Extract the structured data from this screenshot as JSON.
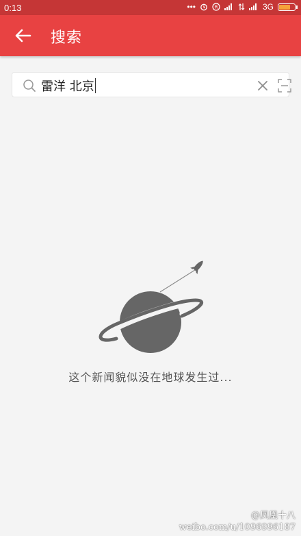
{
  "status_bar": {
    "time": "0:13",
    "network_label": "3G",
    "battery_level": 0.75,
    "icons": [
      "more-dots-icon",
      "alarm-icon",
      "r-circle-icon",
      "signal-icon",
      "data-arrows-icon",
      "signal-icon",
      "battery-icon"
    ]
  },
  "app_bar": {
    "title": "搜索",
    "back_icon": "arrow-left-icon",
    "background": "#e84242"
  },
  "search": {
    "query": "雷洋 北京",
    "search_icon": "search-icon",
    "clear_icon": "close-icon",
    "scan_icon": "scan-icon"
  },
  "empty_state": {
    "illustration": "planet-rocket-icon",
    "message": "这个新闻貌似没在地球发生过..."
  },
  "watermark": {
    "line1": "@凤凰十八",
    "line2": "weibo.com/u/1096996187"
  },
  "colors": {
    "status_bar": "#c53636",
    "accent": "#e84242",
    "background": "#f4f4f4",
    "illustration": "#666666"
  }
}
